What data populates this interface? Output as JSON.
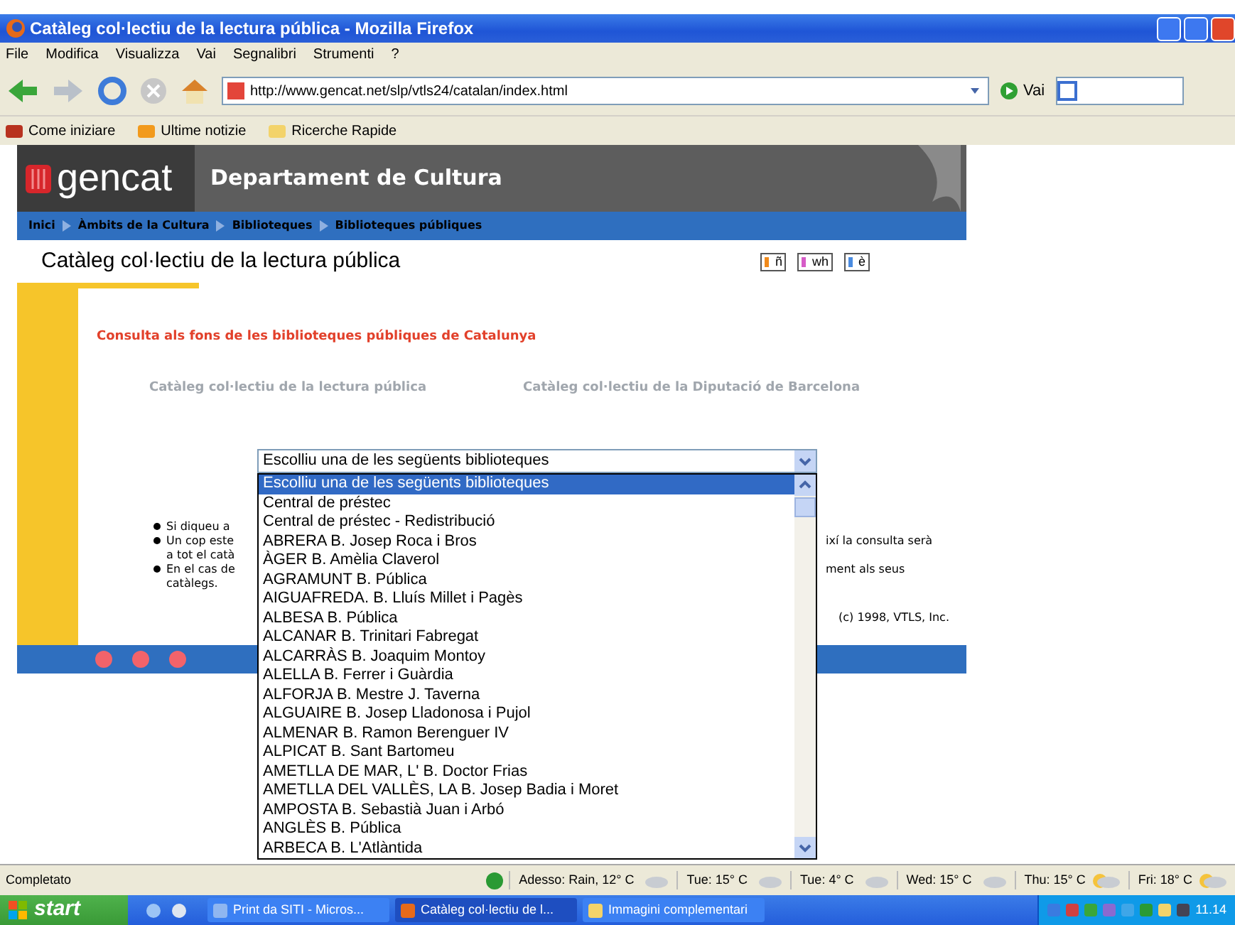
{
  "window": {
    "title": "Catàleg col·lectiu de la lectura pública - Mozilla Firefox"
  },
  "menu": [
    "File",
    "Modifica",
    "Visualizza",
    "Vai",
    "Segnalibri",
    "Strumenti",
    "?"
  ],
  "toolbar": {
    "url": "http://www.gencat.net/slp/vtls24/catalan/index.html",
    "go_label": "Vai"
  },
  "bookmarks": [
    "Come iniziare",
    "Ultime notizie",
    "Ricerche Rapide"
  ],
  "site": {
    "logo": "gencat",
    "department": "Departament de Cultura",
    "breadcrumb": [
      "Inici",
      "Àmbits de la Cultura",
      "Biblioteques",
      "Biblioteques públiques"
    ],
    "heading": "Catàleg col·lectiu de la lectura pública",
    "language_icons": [
      "ñ",
      "wh",
      "è"
    ],
    "intro": "Consulta als fons de les biblioteques públiques de Catalunya",
    "links": [
      "Catàleg col·lectiu de la lectura pública",
      "Catàleg col·lectiu de la Diputació de Barcelona"
    ],
    "select": {
      "value": "Escolliu una de les següents biblioteques",
      "options": [
        {
          "label": "Escolliu una de les següents biblioteques",
          "selected": true
        },
        {
          "label": "Central de préstec",
          "selected": false
        },
        {
          "label": "Central de préstec - Redistribució",
          "selected": false
        },
        {
          "label": "ABRERA B. Josep Roca i Bros",
          "selected": false
        },
        {
          "label": "ÀGER B. Amèlia Claverol",
          "selected": false
        },
        {
          "label": "AGRAMUNT B. Pública",
          "selected": false
        },
        {
          "label": "AIGUAFREDA. B. Lluís Millet i Pagès",
          "selected": false
        },
        {
          "label": "ALBESA B. Pública",
          "selected": false
        },
        {
          "label": "ALCANAR B. Trinitari Fabregat",
          "selected": false
        },
        {
          "label": "ALCARRÀS B. Joaquim Montoy",
          "selected": false
        },
        {
          "label": "ALELLA B. Ferrer i Guàrdia",
          "selected": false
        },
        {
          "label": "ALFORJA B. Mestre J. Taverna",
          "selected": false
        },
        {
          "label": "ALGUAIRE B. Josep Lladonosa i Pujol",
          "selected": false
        },
        {
          "label": "ALMENAR B. Ramon Berenguer IV",
          "selected": false
        },
        {
          "label": "ALPICAT B. Sant Bartomeu",
          "selected": false
        },
        {
          "label": "AMETLLA DE MAR, L' B. Doctor Frias",
          "selected": false
        },
        {
          "label": "AMETLLA DEL VALLÈS, LA B. Josep Badia i Moret",
          "selected": false
        },
        {
          "label": "AMPOSTA B. Sebastià Juan i Arbó",
          "selected": false
        },
        {
          "label": "ANGLÈS B. Pública",
          "selected": false
        },
        {
          "label": "ARBECA B. L'Atlàntida",
          "selected": false
        }
      ]
    },
    "notes": [
      {
        "bullet": true,
        "left": "Si diqueu a"
      },
      {
        "bullet": true,
        "left": "Un cop este",
        "right": "ixí la consulta serà"
      },
      {
        "bullet": false,
        "left": "a tot el catà"
      },
      {
        "bullet": true,
        "left": "En el cas de",
        "right": "ment als seus"
      },
      {
        "bullet": false,
        "left": "catàlegs."
      }
    ],
    "copyright": "(c) 1998, VTLS, Inc."
  },
  "status_bar": {
    "text": "Completato",
    "weather": [
      "Adesso: Rain, 12° C",
      "Tue: 15° C",
      "Tue: 4° C",
      "Wed: 15° C",
      "Thu: 15° C",
      "Fri: 18° C"
    ]
  },
  "taskbar": {
    "start": "start",
    "tasks": [
      {
        "label": "Print da SITI - Micros...",
        "selected": false
      },
      {
        "label": "Catàleg col·lectiu de l...",
        "selected": true
      },
      {
        "label": "Immagini complementari",
        "selected": false
      }
    ],
    "clock": "11.14"
  }
}
